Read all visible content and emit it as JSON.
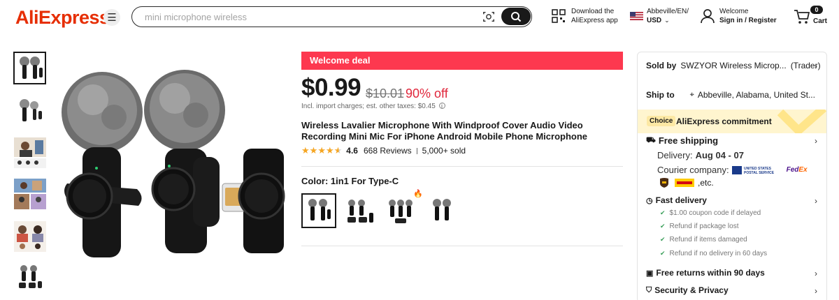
{
  "header": {
    "logo": "AliExpress",
    "search_placeholder": "mini microphone wireless",
    "app_line1": "Download the",
    "app_line2": "AliExpress app",
    "locale_line1": "Abbeville/EN/",
    "locale_line2": "USD",
    "account_line1": "Welcome",
    "account_line2": "Sign in / Register",
    "cart_count": "0",
    "cart_label": "Cart"
  },
  "product": {
    "deal_banner": "Welcome deal",
    "price": "$0.99",
    "original_price": "$10.01",
    "discount": "90% off",
    "tax_note": "Incl. import charges; est. other taxes: $0.45",
    "title": "Wireless Lavalier Microphone With Windproof Cover Audio Video Recording Mini Mic For iPhone Android Mobile Phone Microphone",
    "rating": "4.6",
    "rating_value": 4.6,
    "reviews": "668 Reviews",
    "sold": "5,000+ sold",
    "color_label": "Color: 1in1 For Type-C"
  },
  "panel": {
    "sold_by_label": "Sold by",
    "seller": "SWZYOR Wireless Microp...",
    "seller_type": "(Trader)",
    "ship_to_label": "Ship to",
    "ship_to": "Abbeville, Alabama, United St...",
    "choice_tag": "Choice",
    "commitment": "AliExpress commitment",
    "free_shipping": "Free shipping",
    "delivery_label": "Delivery:",
    "delivery_dates": "Aug 04 - 07",
    "courier_label": "Courier company:",
    "usps": "UNITED STATES POSTAL SERVICE",
    "fedex": "FedEx",
    "etc": ",etc.",
    "fast_delivery": "Fast delivery",
    "fast_items": [
      "$1.00 coupon code if delayed",
      "Refund if package lost",
      "Refund if items damaged",
      "Refund if no delivery in 60 days"
    ],
    "free_returns": "Free returns within 90 days",
    "security": "Security & Privacy"
  },
  "colors": {
    "brand": "#e62e04",
    "deal": "#fd384f",
    "discount": "#e0263b",
    "star": "#f5a623",
    "choice_bg": "#fff5cf"
  }
}
